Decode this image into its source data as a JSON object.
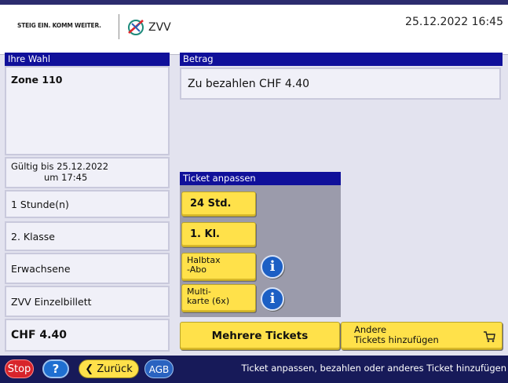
{
  "header": {
    "slogan": "STEIG EIN. KOMM WEITER.",
    "logo_text": "ZVV",
    "datetime": "25.12.2022  16:45"
  },
  "selection": {
    "title": "Ihre Wahl",
    "zone": "Zone 110",
    "valid_line1": "Gültig bis 25.12.2022",
    "valid_line2": "um 17:45",
    "duration": "1 Stunde(n)",
    "class": "2. Klasse",
    "passenger": "Erwachsene",
    "product": "ZVV Einzelbillett",
    "price": "CHF  4.40"
  },
  "amount": {
    "title": "Betrag",
    "text": "Zu bezahlen  CHF  4.40"
  },
  "adjust": {
    "title": "Ticket anpassen",
    "btn_24": "24 Std.",
    "btn_class": "1. Kl.",
    "btn_halbtax_line1": "Halbtax",
    "btn_halbtax_line2": "-Abo",
    "btn_multi_line1": "Multi-",
    "btn_multi_line2": "karte (6x)",
    "info_label": "i"
  },
  "actions": {
    "mehrere": "Mehrere Tickets",
    "andere_line1": "Andere",
    "andere_line2": "Tickets hinzufügen"
  },
  "bottom": {
    "stop": "Stop",
    "help": "?",
    "back": "Zurück",
    "agb": "AGB",
    "status": "Ticket anpassen, bezahlen oder anderes Ticket hinzufügen"
  },
  "colors": {
    "header_blue": "#10109a",
    "button_yellow": "#ffe14a",
    "stop_red": "#d8242b",
    "bar_navy": "#171a59"
  },
  "icons": [
    "zvv-logo-icon",
    "info-icon",
    "cart-icon",
    "chevron-left-icon"
  ]
}
